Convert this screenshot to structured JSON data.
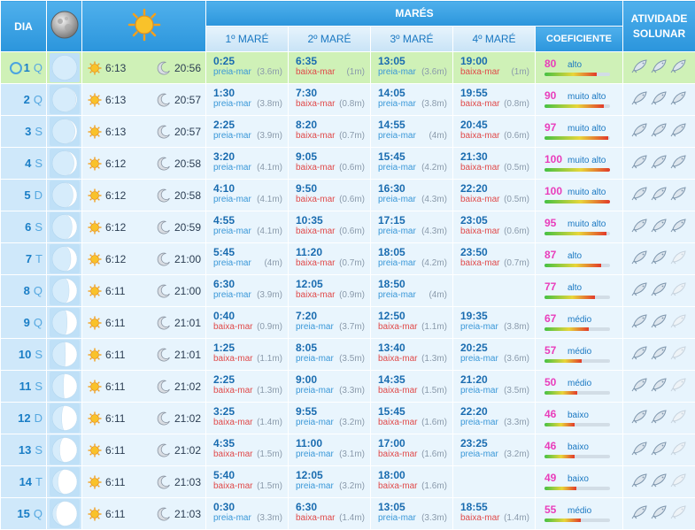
{
  "header": {
    "dia": "DIA",
    "mares": "MARÉS",
    "atividade": "ATIVIDADE SOLUNAR",
    "mare_cols": [
      "1º MARÉ",
      "2º MARÉ",
      "3º MARÉ",
      "4º MARÉ"
    ],
    "coeficiente": "COEFICIENTE"
  },
  "colors": {
    "header": "#2b95dc",
    "today": "#cff1b7",
    "high_tide": "#3a98d8",
    "low_tide": "#e04a4a",
    "coef": "#e93dbb"
  },
  "rows": [
    {
      "day": "1",
      "wd": "Q",
      "phase": 0.0,
      "rise": "6:13",
      "set": "20:56",
      "tides": [
        {
          "time": "0:25",
          "type": "preia-mar",
          "h": "(3.6m)"
        },
        {
          "time": "6:35",
          "type": "baixa-mar",
          "h": "(1m)"
        },
        {
          "time": "13:05",
          "type": "preia-mar",
          "h": "(3.6m)"
        },
        {
          "time": "19:00",
          "type": "baixa-mar",
          "h": "(1m)"
        }
      ],
      "coef": "80",
      "coef_label": "alto",
      "fish": 3
    },
    {
      "day": "2",
      "wd": "Q",
      "phase": 0.04,
      "rise": "6:13",
      "set": "20:57",
      "tides": [
        {
          "time": "1:30",
          "type": "preia-mar",
          "h": "(3.8m)"
        },
        {
          "time": "7:30",
          "type": "baixa-mar",
          "h": "(0.8m)"
        },
        {
          "time": "14:05",
          "type": "preia-mar",
          "h": "(3.8m)"
        },
        {
          "time": "19:55",
          "type": "baixa-mar",
          "h": "(0.8m)"
        }
      ],
      "coef": "90",
      "coef_label": "muito alto",
      "fish": 3
    },
    {
      "day": "3",
      "wd": "S",
      "phase": 0.08,
      "rise": "6:13",
      "set": "20:57",
      "tides": [
        {
          "time": "2:25",
          "type": "preia-mar",
          "h": "(3.9m)"
        },
        {
          "time": "8:20",
          "type": "baixa-mar",
          "h": "(0.7m)"
        },
        {
          "time": "14:55",
          "type": "preia-mar",
          "h": "(4m)"
        },
        {
          "time": "20:45",
          "type": "baixa-mar",
          "h": "(0.6m)"
        }
      ],
      "coef": "97",
      "coef_label": "muito alto",
      "fish": 3
    },
    {
      "day": "4",
      "wd": "S",
      "phase": 0.12,
      "rise": "6:12",
      "set": "20:58",
      "tides": [
        {
          "time": "3:20",
          "type": "preia-mar",
          "h": "(4.1m)"
        },
        {
          "time": "9:05",
          "type": "baixa-mar",
          "h": "(0.6m)"
        },
        {
          "time": "15:45",
          "type": "preia-mar",
          "h": "(4.2m)"
        },
        {
          "time": "21:30",
          "type": "baixa-mar",
          "h": "(0.5m)"
        }
      ],
      "coef": "100",
      "coef_label": "muito alto",
      "fish": 3
    },
    {
      "day": "5",
      "wd": "D",
      "phase": 0.16,
      "rise": "6:12",
      "set": "20:58",
      "tides": [
        {
          "time": "4:10",
          "type": "preia-mar",
          "h": "(4.1m)"
        },
        {
          "time": "9:50",
          "type": "baixa-mar",
          "h": "(0.6m)"
        },
        {
          "time": "16:30",
          "type": "preia-mar",
          "h": "(4.3m)"
        },
        {
          "time": "22:20",
          "type": "baixa-mar",
          "h": "(0.5m)"
        }
      ],
      "coef": "100",
      "coef_label": "muito alto",
      "fish": 3
    },
    {
      "day": "6",
      "wd": "S",
      "phase": 0.2,
      "rise": "6:12",
      "set": "20:59",
      "tides": [
        {
          "time": "4:55",
          "type": "preia-mar",
          "h": "(4.1m)"
        },
        {
          "time": "10:35",
          "type": "baixa-mar",
          "h": "(0.6m)"
        },
        {
          "time": "17:15",
          "type": "preia-mar",
          "h": "(4.3m)"
        },
        {
          "time": "23:05",
          "type": "baixa-mar",
          "h": "(0.6m)"
        }
      ],
      "coef": "95",
      "coef_label": "muito alto",
      "fish": 3
    },
    {
      "day": "7",
      "wd": "T",
      "phase": 0.25,
      "rise": "6:12",
      "set": "21:00",
      "tides": [
        {
          "time": "5:45",
          "type": "preia-mar",
          "h": "(4m)"
        },
        {
          "time": "11:20",
          "type": "baixa-mar",
          "h": "(0.7m)"
        },
        {
          "time": "18:05",
          "type": "preia-mar",
          "h": "(4.2m)"
        },
        {
          "time": "23:50",
          "type": "baixa-mar",
          "h": "(0.7m)"
        }
      ],
      "coef": "87",
      "coef_label": "alto",
      "fish": 2
    },
    {
      "day": "8",
      "wd": "Q",
      "phase": 0.32,
      "rise": "6:11",
      "set": "21:00",
      "tides": [
        {
          "time": "6:30",
          "type": "preia-mar",
          "h": "(3.9m)"
        },
        {
          "time": "12:05",
          "type": "baixa-mar",
          "h": "(0.9m)"
        },
        {
          "time": "18:50",
          "type": "preia-mar",
          "h": "(4m)"
        },
        null
      ],
      "coef": "77",
      "coef_label": "alto",
      "fish": 2
    },
    {
      "day": "9",
      "wd": "Q",
      "phase": 0.4,
      "rise": "6:11",
      "set": "21:01",
      "tides": [
        {
          "time": "0:40",
          "type": "baixa-mar",
          "h": "(0.9m)"
        },
        {
          "time": "7:20",
          "type": "preia-mar",
          "h": "(3.7m)"
        },
        {
          "time": "12:50",
          "type": "baixa-mar",
          "h": "(1.1m)"
        },
        {
          "time": "19:35",
          "type": "preia-mar",
          "h": "(3.8m)"
        }
      ],
      "coef": "67",
      "coef_label": "médio",
      "fish": 2
    },
    {
      "day": "10",
      "wd": "S",
      "phase": 0.47,
      "rise": "6:11",
      "set": "21:01",
      "tides": [
        {
          "time": "1:25",
          "type": "baixa-mar",
          "h": "(1.1m)"
        },
        {
          "time": "8:05",
          "type": "preia-mar",
          "h": "(3.5m)"
        },
        {
          "time": "13:40",
          "type": "baixa-mar",
          "h": "(1.3m)"
        },
        {
          "time": "20:25",
          "type": "preia-mar",
          "h": "(3.6m)"
        }
      ],
      "coef": "57",
      "coef_label": "médio",
      "fish": 2
    },
    {
      "day": "11",
      "wd": "S",
      "phase": 0.55,
      "rise": "6:11",
      "set": "21:02",
      "tides": [
        {
          "time": "2:25",
          "type": "baixa-mar",
          "h": "(1.3m)"
        },
        {
          "time": "9:00",
          "type": "preia-mar",
          "h": "(3.3m)"
        },
        {
          "time": "14:35",
          "type": "baixa-mar",
          "h": "(1.5m)"
        },
        {
          "time": "21:20",
          "type": "preia-mar",
          "h": "(3.5m)"
        }
      ],
      "coef": "50",
      "coef_label": "médio",
      "fish": 2
    },
    {
      "day": "12",
      "wd": "D",
      "phase": 0.62,
      "rise": "6:11",
      "set": "21:02",
      "tides": [
        {
          "time": "3:25",
          "type": "baixa-mar",
          "h": "(1.4m)"
        },
        {
          "time": "9:55",
          "type": "preia-mar",
          "h": "(3.2m)"
        },
        {
          "time": "15:45",
          "type": "baixa-mar",
          "h": "(1.6m)"
        },
        {
          "time": "22:20",
          "type": "preia-mar",
          "h": "(3.3m)"
        }
      ],
      "coef": "46",
      "coef_label": "baixo",
      "fish": 2
    },
    {
      "day": "13",
      "wd": "S",
      "phase": 0.7,
      "rise": "6:11",
      "set": "21:02",
      "tides": [
        {
          "time": "4:35",
          "type": "baixa-mar",
          "h": "(1.5m)"
        },
        {
          "time": "11:00",
          "type": "preia-mar",
          "h": "(3.1m)"
        },
        {
          "time": "17:00",
          "type": "baixa-mar",
          "h": "(1.6m)"
        },
        {
          "time": "23:25",
          "type": "preia-mar",
          "h": "(3.2m)"
        }
      ],
      "coef": "46",
      "coef_label": "baixo",
      "fish": 2
    },
    {
      "day": "14",
      "wd": "T",
      "phase": 0.77,
      "rise": "6:11",
      "set": "21:03",
      "tides": [
        {
          "time": "5:40",
          "type": "baixa-mar",
          "h": "(1.5m)"
        },
        {
          "time": "12:05",
          "type": "preia-mar",
          "h": "(3.2m)"
        },
        {
          "time": "18:00",
          "type": "baixa-mar",
          "h": "(1.6m)"
        },
        null
      ],
      "coef": "49",
      "coef_label": "baixo",
      "fish": 2
    },
    {
      "day": "15",
      "wd": "Q",
      "phase": 0.85,
      "rise": "6:11",
      "set": "21:03",
      "tides": [
        {
          "time": "0:30",
          "type": "preia-mar",
          "h": "(3.3m)"
        },
        {
          "time": "6:30",
          "type": "baixa-mar",
          "h": "(1.4m)"
        },
        {
          "time": "13:05",
          "type": "preia-mar",
          "h": "(3.3m)"
        },
        {
          "time": "18:55",
          "type": "baixa-mar",
          "h": "(1.4m)"
        }
      ],
      "coef": "55",
      "coef_label": "médio",
      "fish": 2
    }
  ]
}
